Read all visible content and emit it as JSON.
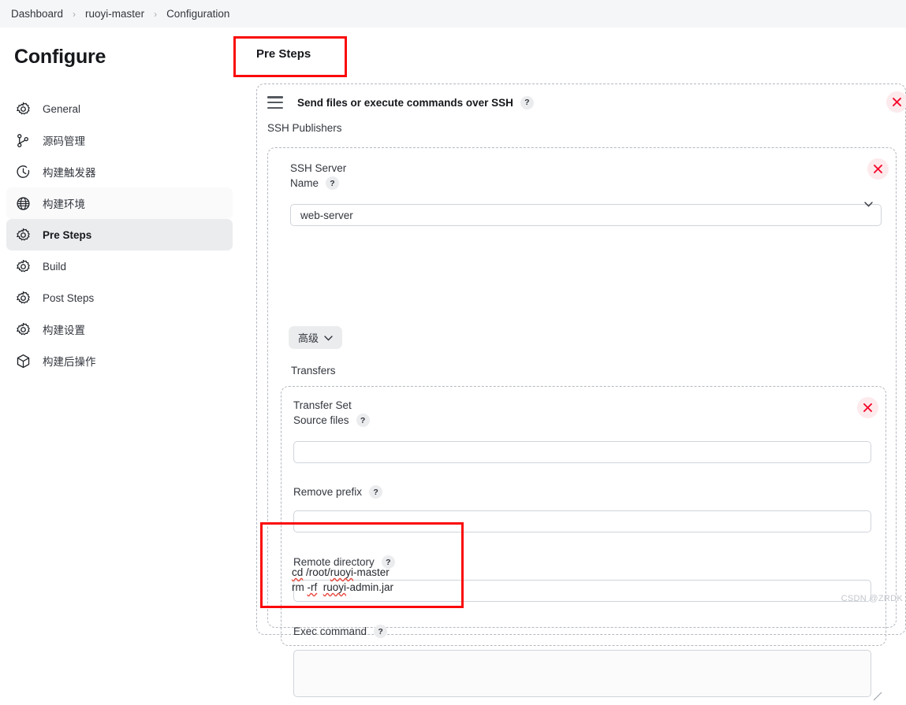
{
  "breadcrumb": {
    "items": [
      "Dashboard",
      "ruoyi-master",
      "Configuration"
    ],
    "separator": "›"
  },
  "sidebar": {
    "title": "Configure",
    "items": [
      {
        "label": "General",
        "icon": "gear-icon",
        "state": "normal"
      },
      {
        "label": "源码管理",
        "icon": "git-branch-icon",
        "state": "normal"
      },
      {
        "label": "构建触发器",
        "icon": "clock-icon",
        "state": "normal"
      },
      {
        "label": "构建环境",
        "icon": "globe-icon",
        "state": "hover"
      },
      {
        "label": "Pre Steps",
        "icon": "gear-icon",
        "state": "selected"
      },
      {
        "label": "Build",
        "icon": "gear-icon",
        "state": "normal"
      },
      {
        "label": "Post Steps",
        "icon": "gear-icon",
        "state": "normal"
      },
      {
        "label": "构建设置",
        "icon": "gear-icon",
        "state": "normal"
      },
      {
        "label": "构建后操作",
        "icon": "package-icon",
        "state": "normal"
      }
    ]
  },
  "main": {
    "page_title": "Pre Steps",
    "panel": {
      "drag_handle_icon": "hamburger-drag-icon",
      "title": "Send files or execute commands over SSH",
      "help": "?",
      "delete_icon": "close-icon",
      "publishers_label": "SSH Publishers",
      "publisher": {
        "delete_icon": "close-icon",
        "server_name_label_line1": "SSH Server",
        "server_name_label_line2": "Name",
        "server_name_help": "?",
        "server_name_value": "web-server",
        "server_name_options": [
          "web-server"
        ],
        "advanced_button": "高级",
        "advanced_chevron_icon": "chevron-down-icon",
        "transfers_label": "Transfers",
        "transfer_set": {
          "delete_icon": "close-icon",
          "title": "Transfer Set",
          "source_files_label": "Source files",
          "source_files_help": "?",
          "source_files_value": "",
          "remove_prefix_label": "Remove prefix",
          "remove_prefix_help": "?",
          "remove_prefix_value": "",
          "remote_directory_label": "Remote directory",
          "remote_directory_help": "?",
          "remote_directory_value": "",
          "exec_command_label": "Exec command",
          "exec_command_help": "?",
          "exec_command_line1": "cd /root/ruoyi-master",
          "exec_command_line2_a": "rm -rf  ",
          "exec_command_line2_b": "ruoyi",
          "exec_command_line2_c": "-admin.jar",
          "exec_command_value": "cd /root/ruoyi-master\nrm -rf  ruoyi-admin.jar"
        }
      }
    }
  },
  "annotations": {
    "highlight_color": "#fa0a0a",
    "boxes": [
      "pre-steps-title",
      "exec-command-field"
    ]
  },
  "watermark": "CSDN @ZRDK",
  "colors": {
    "breadcrumb_bg": "#f5f6f7",
    "selected_nav_bg": "#ebecee",
    "danger": "#e8443a",
    "annotation_red": "#fa0a0a",
    "dashed_border": "#b4b8bf",
    "input_border": "#d0d4da"
  }
}
